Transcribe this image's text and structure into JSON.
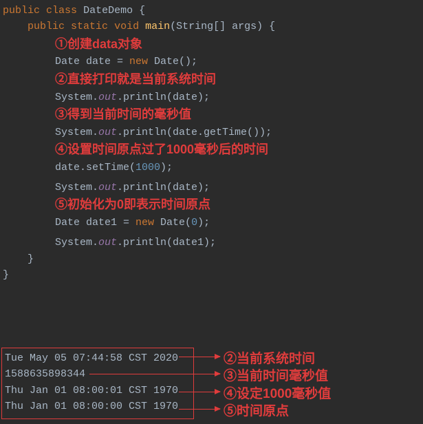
{
  "code": {
    "l0_kw1": "public",
    "l0_kw2": "class",
    "l0_class": "DateDemo",
    "l0_brace": " {",
    "l1_kw1": "public",
    "l1_kw2": "static",
    "l1_kw3": "void",
    "l1_method": "main",
    "l1_params": "(String[] args)",
    "l1_brace": " {",
    "c1": "①创建data对象",
    "l2": "Date date = ",
    "l2_new": "new",
    "l2_rest": " Date();",
    "c2": "②直接打印就是当前系统时间",
    "l3a": "System.",
    "l3b": "out",
    "l3c": ".println(date);",
    "c3": "③得到当前时间的毫秒值",
    "l4a": "System.",
    "l4b": "out",
    "l4c": ".println(date.getTime());",
    "c4": "④设置时间原点过了1000毫秒后的时间",
    "l5a": "date.setTime(",
    "l5n": "1000",
    "l5b": ");",
    "l6a": "System.",
    "l6b": "out",
    "l6c": ".println(date);",
    "c5": "⑤初始化为0即表示时间原点",
    "l7a": "Date date1 = ",
    "l7new": "new",
    "l7b": " Date(",
    "l7n": "0",
    "l7c": ");",
    "l8a": "System.",
    "l8b": "out",
    "l8c": ".println(date1);",
    "l9": "}",
    "l10": "}"
  },
  "output": {
    "o1": "Tue May 05 07:44:58 CST 2020",
    "o2": "1588635898344",
    "o3": "Thu Jan 01 08:00:01 CST 1970",
    "o4": "Thu Jan 01 08:00:00 CST 1970"
  },
  "anno": {
    "a1": "②当前系统时间",
    "a2": "③当前时间毫秒值",
    "a3": "④设定1000毫秒值",
    "a4": "⑤时间原点"
  }
}
